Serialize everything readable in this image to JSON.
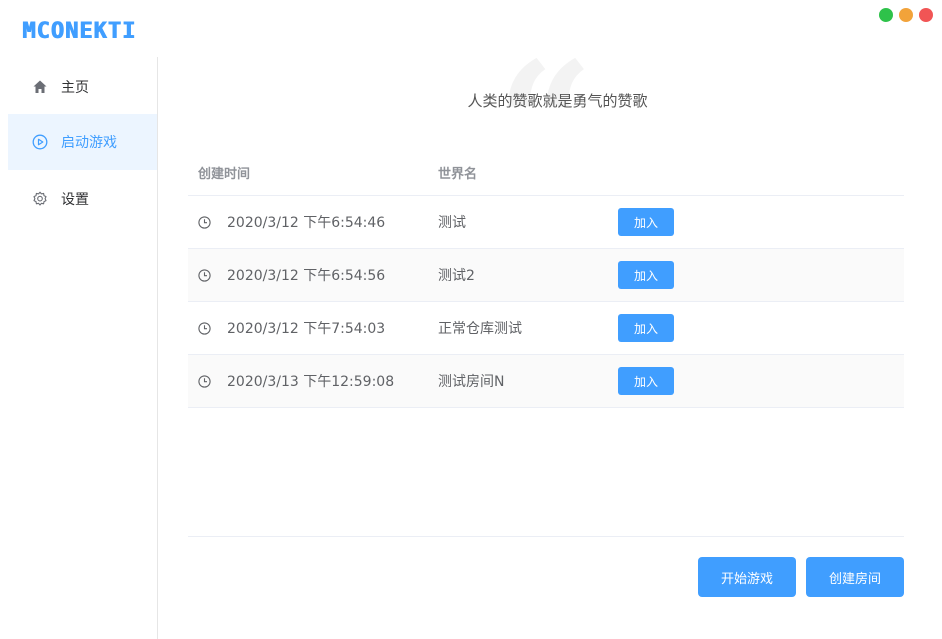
{
  "app": {
    "logo": "MCONEKTI"
  },
  "colors": {
    "accent": "#409eff",
    "active_bg": "#ecf5ff"
  },
  "window_controls": [
    "green-dot",
    "yellow-dot",
    "red-dot"
  ],
  "sidebar": {
    "items": [
      {
        "label": "主页",
        "icon": "home-icon",
        "active": false
      },
      {
        "label": "启动游戏",
        "icon": "play-circle-icon",
        "active": true
      },
      {
        "label": "设置",
        "icon": "gear-icon",
        "active": false
      }
    ]
  },
  "main": {
    "motto": "人类的赞歌就是勇气的赞歌",
    "table": {
      "headers": [
        "创建时间",
        "世界名",
        ""
      ],
      "rows": [
        {
          "time": "2020/3/12 下午6:54:46",
          "name": "测试",
          "action": "加入"
        },
        {
          "time": "2020/3/12 下午6:54:56",
          "name": "测试2",
          "action": "加入"
        },
        {
          "time": "2020/3/12 下午7:54:03",
          "name": "正常仓库测试",
          "action": "加入"
        },
        {
          "time": "2020/3/13 下午12:59:08",
          "name": "测试房间N",
          "action": "加入"
        }
      ]
    },
    "footer": {
      "start_label": "开始游戏",
      "create_label": "创建房间"
    }
  }
}
